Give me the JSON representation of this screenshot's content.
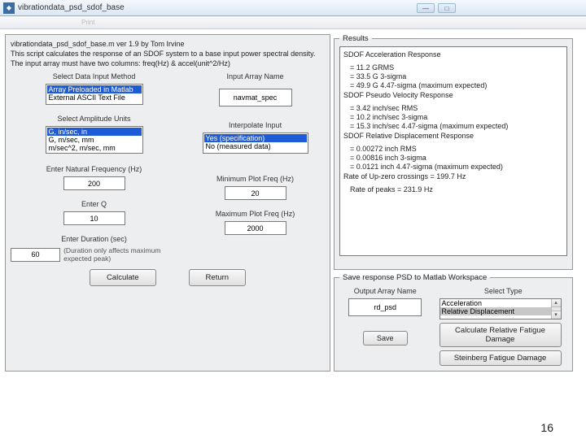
{
  "window": {
    "title": "vibrationdata_psd_sdof_base",
    "icon": "◆"
  },
  "winbtns": {
    "min": "—",
    "max": "□"
  },
  "toolbar": {
    "a": "",
    "b": "",
    "c": "Print"
  },
  "header": {
    "line1": "vibrationdata_psd_sdof_base.m  ver 1.9  by Tom Irvine",
    "line2": "This script calculates the response of an SDOF system to a base input power spectral density.",
    "line3": "The input array must have two columns: freq(Hz) & accel(unit^2/Hz)"
  },
  "labels": {
    "dataMethod": "Select Data Input Method",
    "arrayName": "Input Array Name",
    "ampUnits": "Select Amplitude Units",
    "interp": "Interpolate Input",
    "natFreq": "Enter Natural Frequency (Hz)",
    "minPlot": "Minimum Plot Freq (Hz)",
    "enterQ": "Enter Q",
    "maxPlot": "Maximum Plot Freq (Hz)",
    "duration": "Enter Duration (sec)",
    "durHint": "(Duration only affects maximum expected peak)",
    "outName": "Output Array Name",
    "selType": "Select Type"
  },
  "lists": {
    "dataMethod": [
      {
        "v": "Array Preloaded in Matlab",
        "hl": true
      },
      {
        "v": "External ASCII Text File",
        "hl": false
      }
    ],
    "ampUnits": [
      {
        "v": "G, in/sec, in",
        "hl": true
      },
      {
        "v": "G, m/sec, mm",
        "hl": false
      },
      {
        "v": "m/sec^2, m/sec, mm",
        "hl": false
      }
    ],
    "interp": [
      {
        "v": "Yes  (specification)",
        "hl": true
      },
      {
        "v": "No   (measured data)",
        "hl": false
      }
    ],
    "type": [
      {
        "v": "Acceleration",
        "hl": false
      },
      {
        "v": "Relative Displacement",
        "hl": true
      }
    ]
  },
  "inputs": {
    "arrayName": "navmat_spec",
    "natFreq": "200",
    "minPlot": "20",
    "q": "10",
    "maxPlot": "2000",
    "duration": "60",
    "outName": "rd_psd"
  },
  "buttons": {
    "calc": "Calculate",
    "return": "Return",
    "save": "Save",
    "fatigue": "Calculate Relative Fatigue Damage",
    "steinberg": "Steinberg Fatigue Damage"
  },
  "legends": {
    "results": "Results",
    "save": "Save response PSD to Matlab Workspace"
  },
  "results": {
    "h1": "SDOF Acceleration Response",
    "l1a": "=    11.2 GRMS",
    "l1b": "=    33.5 G 3-sigma",
    "l1c": "=    49.9 G 4.47-sigma (maximum expected)",
    "h2": "SDOF Pseudo Velocity Response",
    "l2a": "=    3.42 inch/sec RMS",
    "l2b": "=    10.2 inch/sec 3-sigma",
    "l2c": "=    15.3 inch/sec 4.47-sigma (maximum expected)",
    "h3": "SDOF Relative Displacement Response",
    "l3a": "=    0.00272 inch RMS",
    "l3b": "=    0.00816 inch 3-sigma",
    "l3c": "=    0.0121 inch 4.47-sigma (maximum expected)",
    "rate1": "Rate of Up-zero crossings =   199.7 Hz",
    "rate2": "Rate of peaks =   231.9 Hz"
  },
  "pagenum": "16"
}
